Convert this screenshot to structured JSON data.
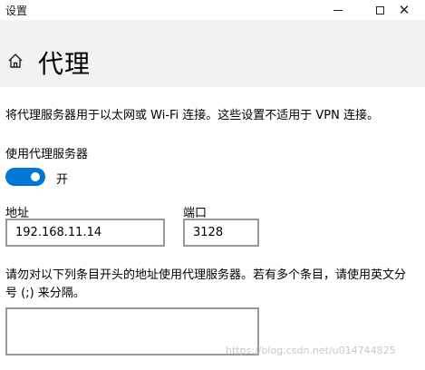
{
  "window": {
    "title": "设置",
    "minimize_icon": "minimize-icon",
    "maximize_icon": "maximize-icon",
    "close_icon": "close-icon",
    "close_glyph": "✕"
  },
  "header": {
    "home_icon": "home-icon",
    "title": "代理",
    "background": "#f2f2f2"
  },
  "main": {
    "description": "将代理服务器用于以太网或 Wi-Fi 连接。这些设置不适用于 VPN 连接。",
    "use_proxy_label": "使用代理服务器",
    "toggle": {
      "state_label": "开",
      "on": true,
      "color": "#0078d7"
    },
    "address": {
      "label": "地址",
      "value": "192.168.11.14"
    },
    "port": {
      "label": "端口",
      "value": "3128"
    },
    "exceptions": {
      "label": "请勿对以下列条目开头的地址使用代理服务器。若有多个条目，请使用英文分号 (;) 来分隔。",
      "value": ""
    }
  },
  "watermark": "https://blog.csdn.net/u014744825"
}
